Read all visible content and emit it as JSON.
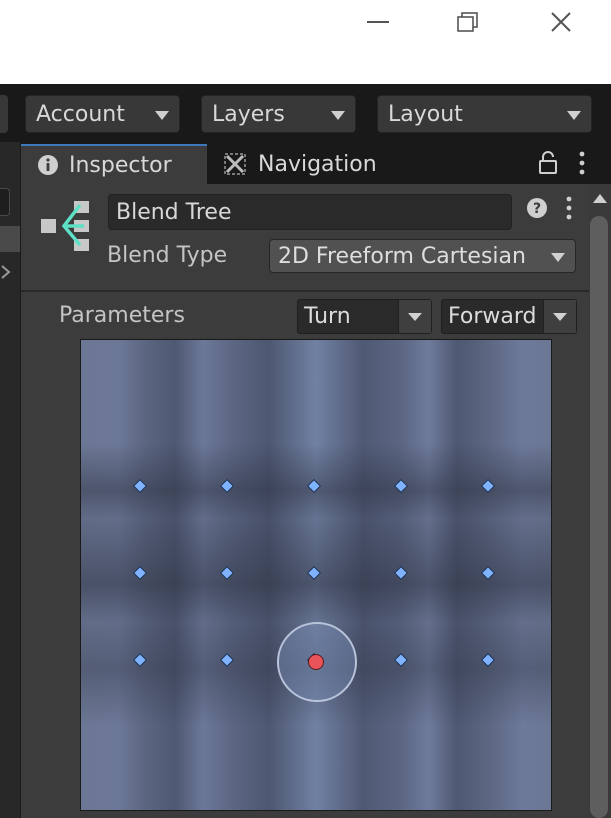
{
  "topbar": {
    "account_label": "Account",
    "layers_label": "Layers",
    "layout_label": "Layout"
  },
  "tabs": {
    "inspector_label": "Inspector",
    "navigation_label": "Navigation"
  },
  "blend_tree": {
    "name": "Blend Tree",
    "blend_type_label": "Blend Type",
    "blend_type_value": "2D Freeform Cartesian",
    "parameters_label": "Parameters",
    "param_x": "Turn",
    "param_y": "Forward"
  },
  "colors": {
    "accent": "#3a79bb",
    "blend_point": "#7fb3ff",
    "current_position": "#e8545a",
    "grid_background": "#6b7794"
  },
  "icons": {
    "minimize": "minimize-icon",
    "maximize": "maximize-icon",
    "close": "close-icon",
    "info": "info-icon",
    "navigation": "navigation-icon",
    "lock": "lock-icon",
    "menu": "kebab-menu-icon",
    "help": "help-icon",
    "blend_tree": "blend-tree-icon"
  }
}
